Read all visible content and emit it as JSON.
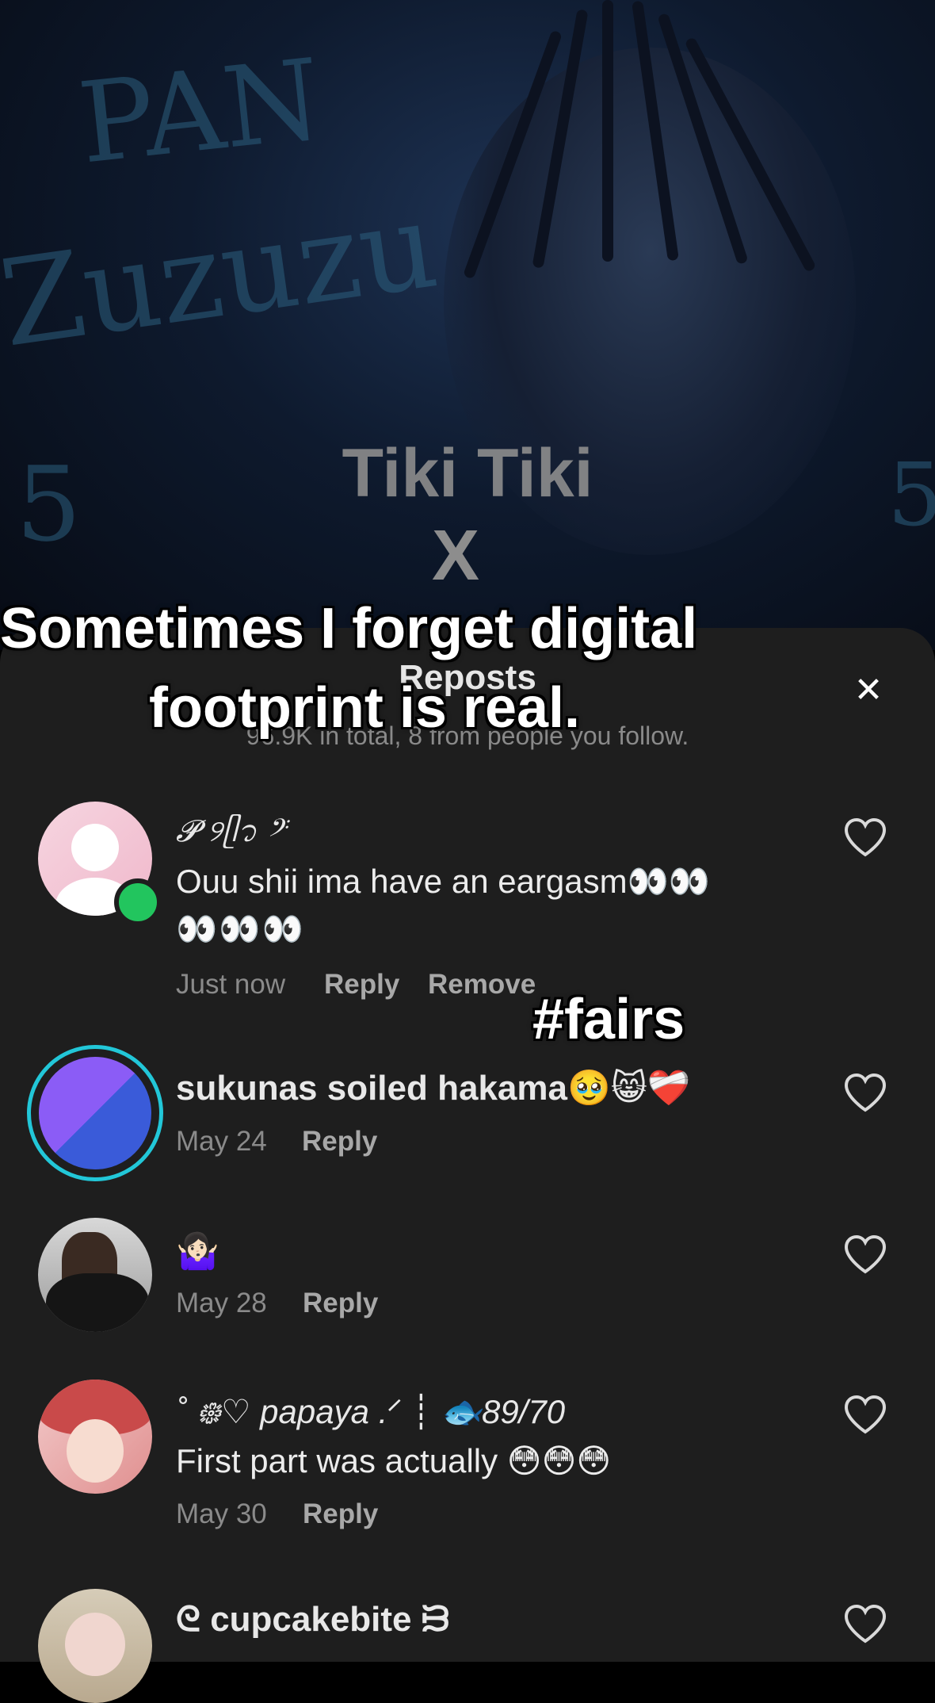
{
  "video": {
    "bg_words": [
      "PAN",
      "Zuzuzu",
      "5",
      "5"
    ],
    "tiki_title": "Tiki Tiki",
    "tiki_x": "X"
  },
  "overlay": {
    "line1": "Sometimes I forget digital",
    "line2": "footprint is real.",
    "hashtag": "#fairs"
  },
  "sheet": {
    "title": "Reposts",
    "subtitle": "96.9K in total, 8 from people you follow.",
    "close_icon": "close-icon"
  },
  "comments": [
    {
      "username": "𝓟 ୨ᥫ᭡ 𝄢",
      "text_line1": "Ouu shii ima have an eargasm👀👀",
      "text_line2": "👀👀👀",
      "time": "Just now",
      "reply": "Reply",
      "remove": "Remove",
      "online": true
    },
    {
      "username": "sukunas soiled hakama🥹😸❤️‍🩹",
      "time": "May 24",
      "reply": "Reply"
    },
    {
      "username": "🤷🏻‍♀️",
      "time": "May 28",
      "reply": "Reply"
    },
    {
      "username": "˚ ᪥♡ papaya .ᐟ ┊ 🐟89/70",
      "text_line1": "First part was actually 😳😳😳",
      "time": "May 30",
      "reply": "Reply"
    },
    {
      "username": "ᘓ cupcakebite ᙣ"
    }
  ],
  "colors": {
    "sheet_bg": "#1e1e1e",
    "online_dot": "#22c55e",
    "story_ring": "#22c7d8"
  }
}
